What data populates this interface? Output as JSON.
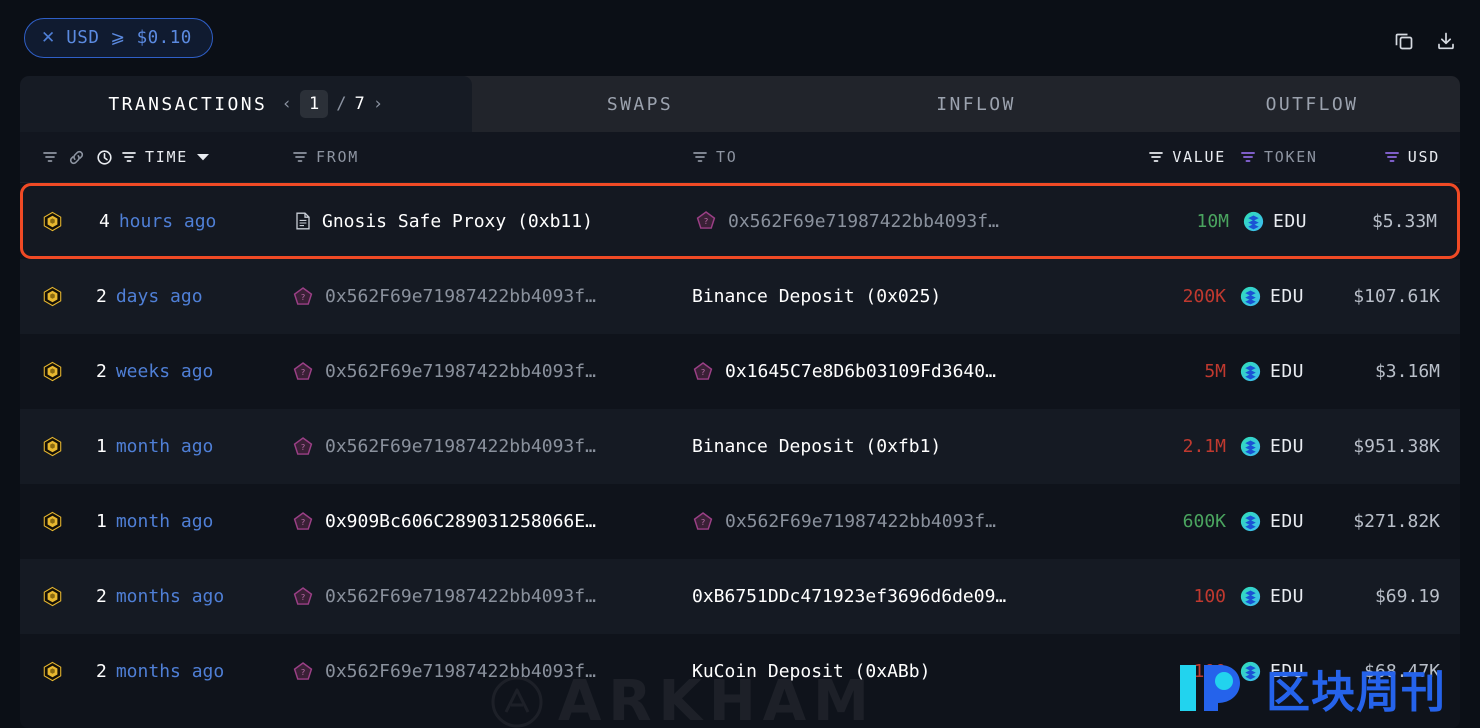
{
  "filter_chip": {
    "close_icon": "close-icon",
    "label": "USD  ⩾  $0.10"
  },
  "topbar": {
    "copy_icon": "copy-icon",
    "download_icon": "download-icon"
  },
  "tabs": {
    "active": {
      "label": "TRANSACTIONS",
      "prev_arrow": "‹",
      "next_arrow": "›",
      "page_current": "1",
      "page_sep": "/",
      "page_total": "7"
    },
    "others": [
      {
        "label": "SWAPS"
      },
      {
        "label": "INFLOW"
      },
      {
        "label": "OUTFLOW"
      }
    ]
  },
  "columns": {
    "chain": "",
    "time": "TIME",
    "from": "FROM",
    "to": "TO",
    "value": "VALUE",
    "token": "TOKEN",
    "usd": "USD"
  },
  "colors": {
    "accent_blue": "#4f7fd6",
    "highlight_orange": "#f04a25",
    "value_positive": "#4aa45f",
    "value_negative": "#c0392f",
    "token_icon": "#2ee6c5",
    "chain_icon": "#e8b830",
    "entity_icon": "#9b3f86"
  },
  "rows": [
    {
      "highlight": true,
      "time_num": "4",
      "time_rest": "hours ago",
      "from_icon": "document-icon",
      "from": "Gnosis Safe Proxy (0xb11)",
      "from_bright": true,
      "to_icon": "entity-icon",
      "to": "0x562F69e71987422bb4093f…",
      "to_bright": false,
      "value": "10M",
      "value_sign": "pos",
      "token": "EDU",
      "usd": "$5.33M"
    },
    {
      "highlight": false,
      "time_num": "2",
      "time_rest": "days ago",
      "from_icon": "entity-icon",
      "from": "0x562F69e71987422bb4093f…",
      "from_bright": false,
      "to_icon": "none",
      "to": "Binance Deposit (0x025)",
      "to_bright": true,
      "value": "200K",
      "value_sign": "neg",
      "token": "EDU",
      "usd": "$107.61K"
    },
    {
      "highlight": false,
      "time_num": "2",
      "time_rest": "weeks ago",
      "from_icon": "entity-icon",
      "from": "0x562F69e71987422bb4093f…",
      "from_bright": false,
      "to_icon": "entity-icon",
      "to": "0x1645C7e8D6b03109Fd3640…",
      "to_bright": true,
      "value": "5M",
      "value_sign": "neg",
      "token": "EDU",
      "usd": "$3.16M"
    },
    {
      "highlight": false,
      "time_num": "1",
      "time_rest": "month ago",
      "from_icon": "entity-icon",
      "from": "0x562F69e71987422bb4093f…",
      "from_bright": false,
      "to_icon": "none",
      "to": "Binance Deposit (0xfb1)",
      "to_bright": true,
      "value": "2.1M",
      "value_sign": "neg",
      "token": "EDU",
      "usd": "$951.38K"
    },
    {
      "highlight": false,
      "time_num": "1",
      "time_rest": "month ago",
      "from_icon": "entity-icon",
      "from": "0x909Bc606C289031258066E…",
      "from_bright": true,
      "to_icon": "entity-icon",
      "to": "0x562F69e71987422bb4093f…",
      "to_bright": false,
      "value": "600K",
      "value_sign": "pos",
      "token": "EDU",
      "usd": "$271.82K"
    },
    {
      "highlight": false,
      "time_num": "2",
      "time_rest": "months ago",
      "from_icon": "entity-icon",
      "from": "0x562F69e71987422bb4093f…",
      "from_bright": false,
      "to_icon": "none",
      "to": "0xB6751DDc471923ef3696d6de09…",
      "to_bright": true,
      "value": "100",
      "value_sign": "neg",
      "token": "EDU",
      "usd": "$69.19"
    },
    {
      "highlight": false,
      "time_num": "2",
      "time_rest": "months ago",
      "from_icon": "entity-icon",
      "from": "0x562F69e71987422bb4093f…",
      "from_bright": false,
      "to_icon": "none",
      "to": "KuCoin Deposit (0xABb)",
      "to_bright": true,
      "value": "100",
      "value_sign": "neg",
      "token": "EDU",
      "usd": "$68.47K"
    }
  ],
  "watermarks": {
    "arkham": "ARKHAM",
    "zkzk": "区块周刊"
  }
}
